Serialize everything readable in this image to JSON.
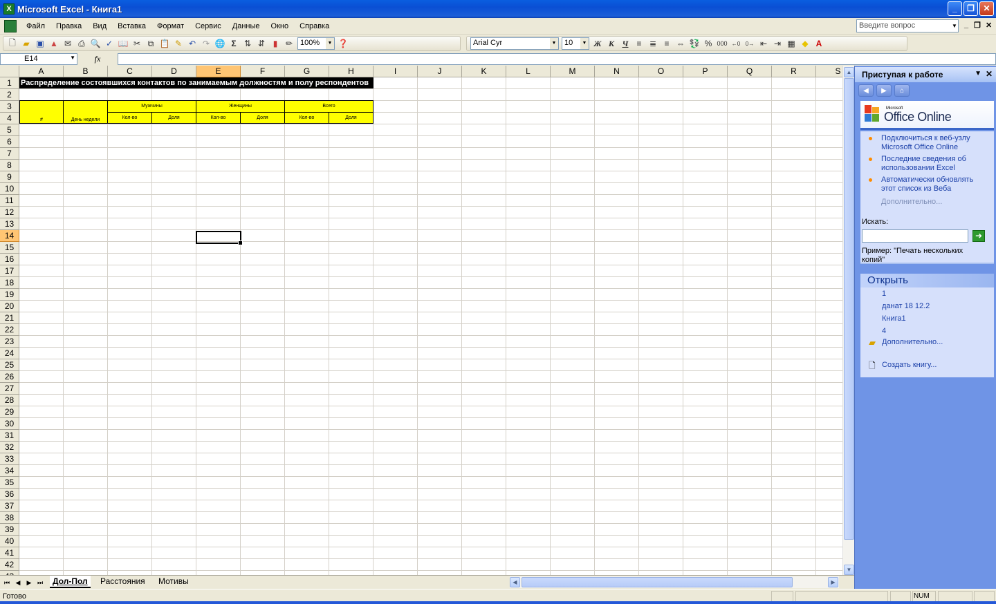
{
  "window": {
    "title": "Microsoft Excel - Книга1",
    "buttons": [
      "_",
      "❐",
      "✕"
    ]
  },
  "menu": {
    "items": [
      "Файл",
      "Правка",
      "Вид",
      "Вставка",
      "Формат",
      "Сервис",
      "Данные",
      "Окно",
      "Справка"
    ],
    "ask_placeholder": "Введите вопрос"
  },
  "toolbar": {
    "zoom": "100%",
    "font": "Arial Cyr",
    "font_size": "10",
    "bold": "Ж",
    "italic": "К",
    "underline": "Ч",
    "percent": "%",
    "thousands": "000"
  },
  "formula_bar": {
    "name_box": "E14",
    "fx": "fx",
    "formula": ""
  },
  "grid": {
    "columns": [
      "A",
      "B",
      "C",
      "D",
      "E",
      "F",
      "G",
      "H",
      "I",
      "J",
      "K",
      "L",
      "M",
      "N",
      "O",
      "P",
      "Q",
      "R",
      "S"
    ],
    "selected_column": "E",
    "selected_row": "14",
    "title_text": "Распределение состоявшихся контактов по занимаемым должностям и полу респондентов",
    "table": {
      "col_a_header": "#",
      "col_b_header": "День недели",
      "men": "Мужчины",
      "women": "Женщины",
      "total": "Всего",
      "count": "Кол-во",
      "share": "Доля"
    }
  },
  "sheets": {
    "tabs": [
      "Дол-Пол",
      "Расстояния",
      "Мотивы"
    ],
    "active": "Дол-Пол"
  },
  "status": {
    "text": "Готово",
    "num": "NUM"
  },
  "taskpane": {
    "title": "Приступая к работе",
    "logo_small": "Microsoft",
    "logo_big": "Office Online",
    "links": [
      "Подключиться к веб-узлу Microsoft Office Online",
      "Последние сведения об использовании Excel",
      "Автоматически обновлять этот список из Веба"
    ],
    "more": "Дополнительно...",
    "search_label": "Искать:",
    "example": "Пример:  \"Печать нескольких копий\"",
    "open_header": "Открыть",
    "files": [
      "1",
      "данат 18 12.2",
      "Книга1",
      "4"
    ],
    "open_more": "Дополнительно...",
    "create": "Создать книгу..."
  }
}
